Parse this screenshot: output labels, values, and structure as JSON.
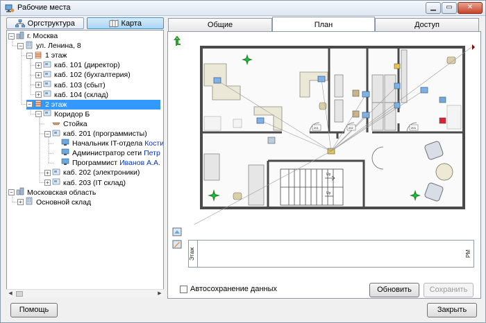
{
  "window": {
    "title": "Рабочие места",
    "min_glyph": "▁",
    "max_glyph": "▭",
    "close_glyph": "✕"
  },
  "left_tabs": {
    "org": "Оргструктура",
    "map": "Карта"
  },
  "tree": [
    {
      "label": "г. Москва",
      "indent": 0,
      "expander": "−",
      "icon": "city"
    },
    {
      "label": "ул. Ленина, 8",
      "indent": 1,
      "expander": "−",
      "icon": "building"
    },
    {
      "label": "1 этаж",
      "indent": 2,
      "expander": "−",
      "icon": "floor"
    },
    {
      "label": "каб. 101 (директор)",
      "indent": 3,
      "expander": "+",
      "icon": "room"
    },
    {
      "label": "каб. 102 (бухгалтерия)",
      "indent": 3,
      "expander": "+",
      "icon": "room"
    },
    {
      "label": "каб. 103 (сбыт)",
      "indent": 3,
      "expander": "+",
      "icon": "room"
    },
    {
      "label": "каб. 104 (склад)",
      "indent": 3,
      "expander": "+",
      "icon": "room"
    },
    {
      "label": "2 этаж",
      "indent": 2,
      "expander": "−",
      "icon": "floor",
      "selected": true
    },
    {
      "label": "Коридор Б",
      "indent": 3,
      "expander": "−",
      "icon": "room"
    },
    {
      "label": "Стойка",
      "indent": 4,
      "expander": "",
      "icon": "desk"
    },
    {
      "label": "каб. 201 (программисты)",
      "indent": 4,
      "expander": "−",
      "icon": "room"
    },
    {
      "label": "Начальник IT-отдела",
      "indent": 5,
      "expander": "",
      "icon": "pc",
      "link": "Кости"
    },
    {
      "label": "Администратор сети",
      "indent": 5,
      "expander": "",
      "icon": "pc",
      "link": "Петр"
    },
    {
      "label": "Программист",
      "indent": 5,
      "expander": "",
      "icon": "pc",
      "link": "Иванов А.А."
    },
    {
      "label": "каб. 202 (электроники)",
      "indent": 4,
      "expander": "+",
      "icon": "room"
    },
    {
      "label": "каб. 203 (IT склад)",
      "indent": 4,
      "expander": "+",
      "icon": "room"
    },
    {
      "label": "Московская область",
      "indent": 0,
      "expander": "−",
      "icon": "city"
    },
    {
      "label": "Основной склад",
      "indent": 1,
      "expander": "+",
      "icon": "building"
    }
  ],
  "right_tabs": [
    "Общие",
    "План",
    "Доступ"
  ],
  "plan": {
    "room_numbers": [
      "201",
      "202",
      "203"
    ],
    "stairs_label": "Up",
    "arrow_up_glyph": "↰"
  },
  "layers": {
    "left_label": "Этаж",
    "right_label": "РМ"
  },
  "autosave_label": "Автосохранение данных",
  "buttons": {
    "refresh": "Обновить",
    "save": "Сохранить",
    "help": "Помощь",
    "close": "Закрыть"
  },
  "colors": {
    "selection": "#3399ff",
    "link": "#0033cc",
    "accent": "#a9d5f3"
  }
}
